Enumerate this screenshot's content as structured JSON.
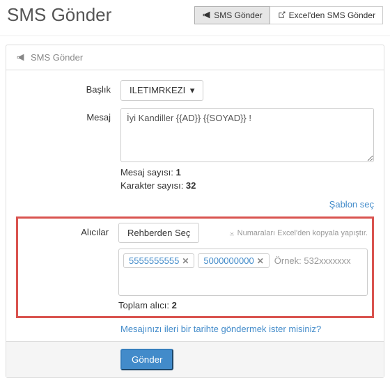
{
  "header": {
    "title": "SMS Gönder",
    "sms_btn": "SMS Gönder",
    "excel_btn": "Excel'den SMS Gönder"
  },
  "panel": {
    "title": "SMS Gönder",
    "title_label": "Başlık",
    "title_value": "ILETIMRKEZI",
    "message_label": "Mesaj",
    "message_value": "İyi Kandiller {{AD}} {{SOYAD}} !",
    "msg_count_label": "Mesaj sayısı: ",
    "msg_count": "1",
    "char_count_label": "Karakter sayısı: ",
    "char_count": "32",
    "template_link": "Şablon seç",
    "recipients_label": "Alıcılar",
    "contacts_btn": "Rehberden Seç",
    "excel_hint": "Numaraları Excel'den kopyala yapıştır.",
    "tags": [
      "5555555555",
      "5000000000"
    ],
    "placeholder": "Örnek: 532xxxxxxx",
    "total_label": "Toplam alıcı: ",
    "total": "2",
    "schedule_link": "Mesajınızı ileri bir tarihte göndermek ister misiniz?",
    "submit": "Gönder"
  }
}
